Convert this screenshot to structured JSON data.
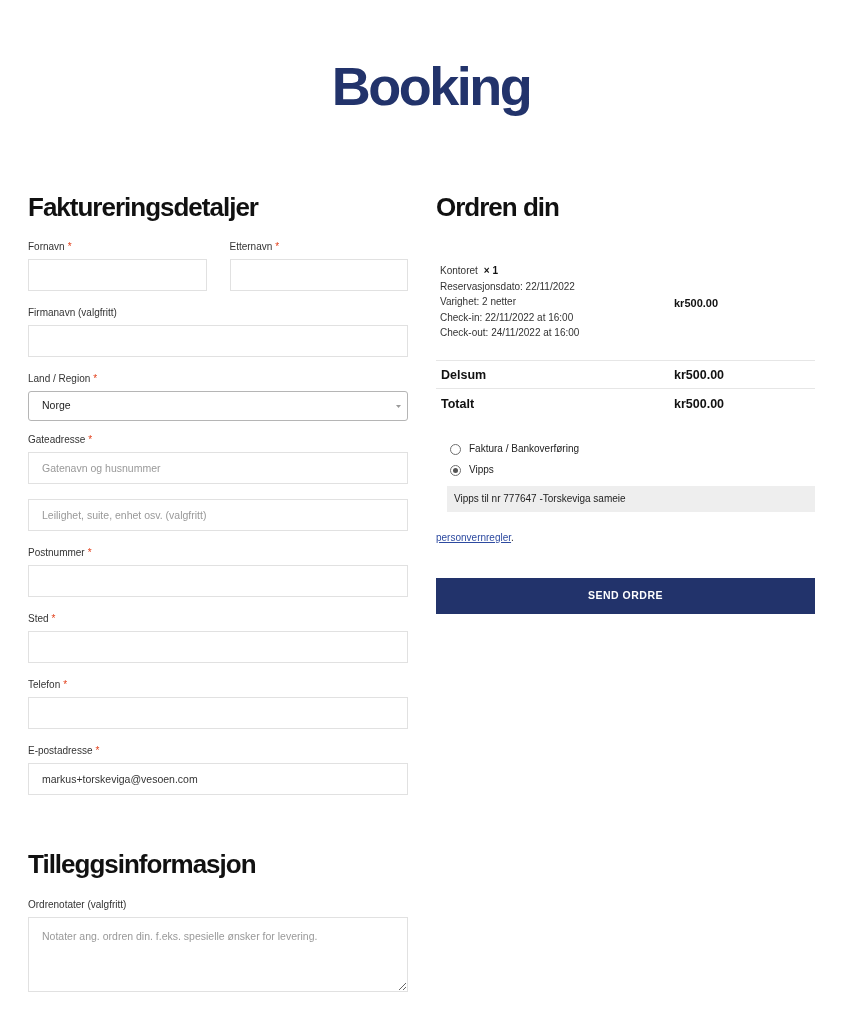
{
  "site": {
    "logo": "Booking"
  },
  "billing": {
    "title": "Faktureringsdetaljer",
    "required_mark": "*",
    "rows": [
      [
        {
          "kind": "text",
          "label": "Fornavn",
          "required": true
        },
        {
          "kind": "text",
          "label": "Etternavn",
          "required": true
        }
      ],
      [
        {
          "kind": "text",
          "label": "Firmanavn (valgfritt)",
          "required": false
        }
      ],
      [
        {
          "kind": "select",
          "label": "Land / Region",
          "required": true,
          "value": "Norge"
        }
      ],
      [
        {
          "kind": "text",
          "label": "Gateadresse",
          "required": true,
          "placeholder": "Gatenavn og husnummer"
        }
      ],
      [
        {
          "kind": "text",
          "placeholder": "Leilighet, suite, enhet osv. (valgfritt)"
        }
      ],
      [
        {
          "kind": "text",
          "label": "Postnummer",
          "required": true
        }
      ],
      [
        {
          "kind": "text",
          "label": "Sted",
          "required": true
        }
      ],
      [
        {
          "kind": "text",
          "label": "Telefon",
          "required": true
        }
      ],
      [
        {
          "kind": "text",
          "label": "E-postadresse",
          "required": true,
          "value": "markus+torskeviga@vesoen.com"
        }
      ]
    ]
  },
  "additional": {
    "title": "Tilleggsinformasjon",
    "fields": [
      {
        "kind": "textarea",
        "label": "Ordrenotater (valgfritt)",
        "required": false,
        "placeholder": "Notater ang. ordren din. f.eks. spesielle ønsker for levering."
      }
    ]
  },
  "order": {
    "title": "Ordren din",
    "items": [
      {
        "name": "Kontoret",
        "quantity": "× 1",
        "details": [
          "Reservasjonsdato: 22/11/2022",
          "Varighet: 2 netter",
          "Check-in: 22/11/2022 at 16:00",
          "Check-out: 24/11/2022 at 16:00"
        ],
        "total": "kr500.00"
      }
    ],
    "totals": [
      {
        "label": "Delsum",
        "amount": "kr500.00"
      },
      {
        "label": "Totalt",
        "amount": "kr500.00"
      }
    ]
  },
  "payment": {
    "methods": [
      {
        "label": "Faktura / Bankoverføring",
        "selected": false
      },
      {
        "label": "Vipps",
        "selected": true,
        "description": "Vipps til nr 777647 -Torskeviga sameie"
      }
    ]
  },
  "privacy": {
    "link": "personvernregler",
    "suffix": "."
  },
  "submit": {
    "label": "SEND ORDRE"
  }
}
